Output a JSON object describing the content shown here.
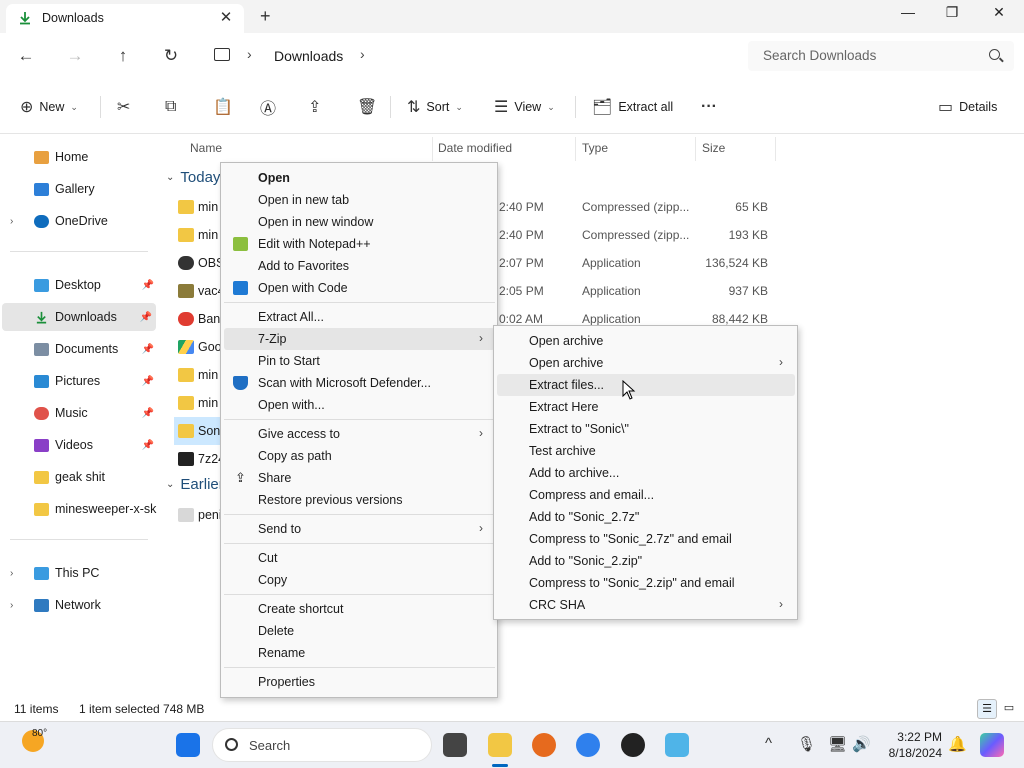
{
  "window": {
    "tab_title": "Downloads",
    "new_tab": "+",
    "minimize": "—",
    "maximize": "❐",
    "close": "✕"
  },
  "address": {
    "crumb": "Downloads",
    "search_placeholder": "Search Downloads"
  },
  "toolbar": {
    "new_label": "New",
    "sort_label": "Sort",
    "view_label": "View",
    "extract_all_label": "Extract all",
    "details_label": "Details"
  },
  "sidebar": {
    "items": [
      {
        "label": "Home"
      },
      {
        "label": "Gallery"
      },
      {
        "label": "OneDrive"
      },
      {
        "label": "Desktop"
      },
      {
        "label": "Downloads"
      },
      {
        "label": "Documents"
      },
      {
        "label": "Pictures"
      },
      {
        "label": "Music"
      },
      {
        "label": "Videos"
      },
      {
        "label": "geak shit"
      },
      {
        "label": "minesweeper-x-skin"
      },
      {
        "label": "This PC"
      },
      {
        "label": "Network"
      }
    ]
  },
  "columns": {
    "name": "Name",
    "date": "Date modified",
    "type": "Type",
    "size": "Size"
  },
  "groups": {
    "today": "Today",
    "earlier": "Earlier"
  },
  "files": [
    {
      "name": "min",
      "date": "2:40 PM",
      "type": "Compressed (zipp...",
      "size": "65 KB"
    },
    {
      "name": "min",
      "date": "2:40 PM",
      "type": "Compressed (zipp...",
      "size": "193 KB"
    },
    {
      "name": "OBS",
      "date": "2:07 PM",
      "type": "Application",
      "size": "136,524 KB"
    },
    {
      "name": "vac4",
      "date": "2:05 PM",
      "type": "Application",
      "size": "937 KB"
    },
    {
      "name": "Band",
      "date": "0:02 AM",
      "type": "Application",
      "size": "88,442 KB"
    },
    {
      "name": "Goo",
      "date": "",
      "type": "",
      "size": ""
    },
    {
      "name": "min",
      "date": "",
      "type": "",
      "size": ""
    },
    {
      "name": "min",
      "date": "",
      "type": "",
      "size": ""
    },
    {
      "name": "Soni",
      "date": "",
      "type": "",
      "size": ""
    },
    {
      "name": "7z24",
      "date": "",
      "type": "",
      "size": ""
    }
  ],
  "earlier_files": [
    {
      "name": "peni"
    }
  ],
  "status": {
    "count": "11 items",
    "selection": "1 item selected  748 MB"
  },
  "context_menu": {
    "items": [
      "Open",
      "Open in new tab",
      "Open in new window",
      "Edit with Notepad++",
      "Add to Favorites",
      "Open with Code",
      "Extract All...",
      "7-Zip",
      "Pin to Start",
      "Scan with Microsoft Defender...",
      "Open with...",
      "Give access to",
      "Copy as path",
      "Share",
      "Restore previous versions",
      "Send to",
      "Cut",
      "Copy",
      "Create shortcut",
      "Delete",
      "Rename",
      "Properties"
    ]
  },
  "submenu": {
    "items": [
      "Open archive",
      "Open archive",
      "Extract files...",
      "Extract Here",
      "Extract to \"Sonic\\\"",
      "Test archive",
      "Add to archive...",
      "Compress and email...",
      "Add to \"Sonic_2.7z\"",
      "Compress to \"Sonic_2.7z\" and email",
      "Add to \"Sonic_2.zip\"",
      "Compress to \"Sonic_2.zip\" and email",
      "CRC SHA"
    ]
  },
  "taskbar": {
    "temp": "80°",
    "search_label": "Search",
    "time": "3:22 PM",
    "date": "8/18/2024"
  }
}
